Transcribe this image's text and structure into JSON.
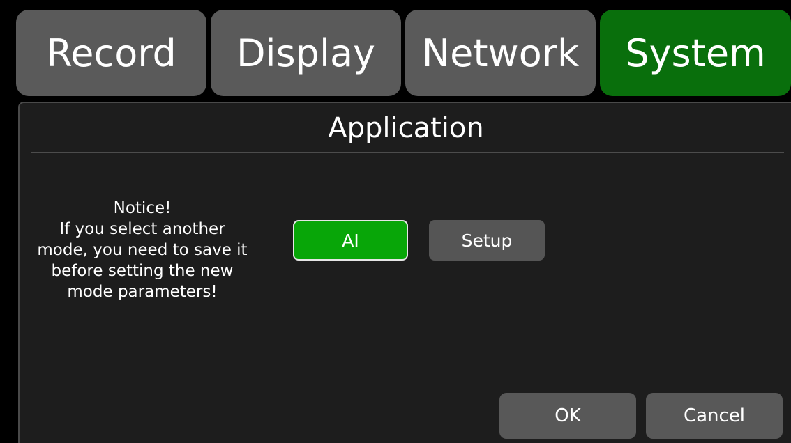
{
  "tabs": [
    {
      "label": "Record",
      "active": false
    },
    {
      "label": "Display",
      "active": false
    },
    {
      "label": "Network",
      "active": false
    },
    {
      "label": "System",
      "active": true
    }
  ],
  "panel": {
    "title": "Application",
    "notice_lines": [
      "Notice!",
      "If you select another",
      "mode, you need to save it",
      "before setting the new",
      "mode parameters!"
    ],
    "modes": [
      {
        "label": "AI",
        "selected": true
      },
      {
        "label": "Setup",
        "selected": false
      }
    ],
    "ok_label": "OK",
    "cancel_label": "Cancel"
  },
  "colors": {
    "tab_inactive": "#5a5a5a",
    "tab_active": "#096f0c",
    "selected_mode": "#08a608",
    "button": "#555555",
    "panel_bg": "#1d1d1d"
  }
}
